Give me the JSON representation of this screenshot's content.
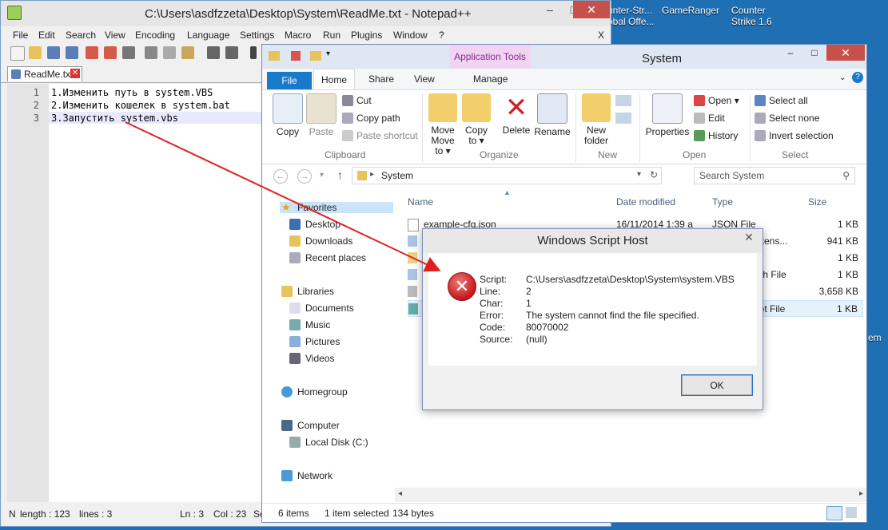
{
  "desktop": {
    "icons": [
      {
        "label_line1": "unter-Str...",
        "label_line2": "obal Offe..."
      },
      {
        "label_line1": "GameRanger",
        "label_line2": ""
      },
      {
        "label_line1": "Counter",
        "label_line2": "Strike 1.6"
      }
    ],
    "right_label": "em"
  },
  "notepad": {
    "title": "C:\\Users\\asdfzzeta\\Desktop\\System\\ReadMe.txt - Notepad++",
    "window_controls": {
      "min": "–",
      "max": "□",
      "close": "✕"
    },
    "menu": [
      "File",
      "Edit",
      "Search",
      "View",
      "Encoding",
      "Language",
      "Settings",
      "Macro",
      "Run",
      "Plugins",
      "Window",
      "?"
    ],
    "menu_close": "X",
    "tab_label": "ReadMe.txt",
    "lines": [
      {
        "num": "1",
        "text": "1.Изменить путь в system.VBS"
      },
      {
        "num": "2",
        "text": "2.Изменить кошелек в system.bat"
      },
      {
        "num": "3",
        "text": "3.Запустить system.vbs"
      }
    ],
    "status": {
      "type": "N",
      "length": "length : 123",
      "lines": "lines : 3",
      "ln": "Ln : 3",
      "col": "Col : 23",
      "sel": "Se"
    }
  },
  "explorer": {
    "title": "System",
    "app_tools": "Application Tools",
    "tabs": {
      "file": "File",
      "home": "Home",
      "share": "Share",
      "view": "View",
      "manage": "Manage"
    },
    "ribbon": {
      "copy": "Copy",
      "paste": "Paste",
      "cut": "Cut",
      "copy_path": "Copy path",
      "paste_shortcut": "Paste shortcut",
      "move_to": "Move to ▾",
      "move_label": "Move",
      "copy_to_label": "Copy",
      "copy_to": "to ▾",
      "delete": "Delete",
      "rename": "Rename",
      "new_folder_1": "New",
      "new_folder_2": "folder",
      "properties": "Properties",
      "open": "Open ▾",
      "edit": "Edit",
      "history": "History",
      "select_all": "Select all",
      "select_none": "Select none",
      "invert_selection": "Invert selection",
      "groups": {
        "clipboard": "Clipboard",
        "organize": "Organize",
        "new": "New",
        "open": "Open",
        "select": "Select"
      }
    },
    "address": "System",
    "search_placeholder": "Search System",
    "nav": {
      "favorites": "Favorites",
      "desktop": "Desktop",
      "downloads": "Downloads",
      "recent": "Recent places",
      "libraries": "Libraries",
      "documents": "Documents",
      "music": "Music",
      "pictures": "Pictures",
      "videos": "Videos",
      "homegroup": "Homegroup",
      "computer": "Computer",
      "local_disk": "Local Disk (C:)",
      "network": "Network"
    },
    "columns": {
      "name": "Name",
      "date": "Date modified",
      "type": "Type",
      "size": "Size"
    },
    "files": [
      {
        "name": "example-cfg.json",
        "date": "16/11/2014 1:39 a",
        "type": "JSON File",
        "size": "1 KB"
      },
      {
        "name": "",
        "date": "",
        "type": "extens...",
        "size": "941 KB"
      },
      {
        "name": "",
        "date": "",
        "type": "",
        "size": "1 KB"
      },
      {
        "name": "",
        "date": "",
        "type": "tch File",
        "size": "1 KB"
      },
      {
        "name": "",
        "date": "",
        "type": "",
        "size": "3,658 KB"
      },
      {
        "name": "",
        "date": "",
        "type": "ipt File",
        "size": "1 KB"
      }
    ],
    "status": {
      "items": "6 items",
      "selected": "1 item selected",
      "bytes": "134 bytes"
    }
  },
  "dialog": {
    "title": "Windows Script Host",
    "close": "✕",
    "rows": [
      {
        "label": "Script:",
        "value": "C:\\Users\\asdfzzeta\\Desktop\\System\\system.VBS"
      },
      {
        "label": "Line:",
        "value": "2"
      },
      {
        "label": "Char:",
        "value": "1"
      },
      {
        "label": "Error:",
        "value": "The system cannot find the file specified."
      },
      {
        "label": "Code:",
        "value": "80070002"
      },
      {
        "label": "Source:",
        "value": "(null)"
      }
    ],
    "ok_label": "OK"
  },
  "colors": {
    "arrow": "#e02020",
    "ribbon_file": "#1979ca",
    "error_icon": "#c6161b"
  }
}
